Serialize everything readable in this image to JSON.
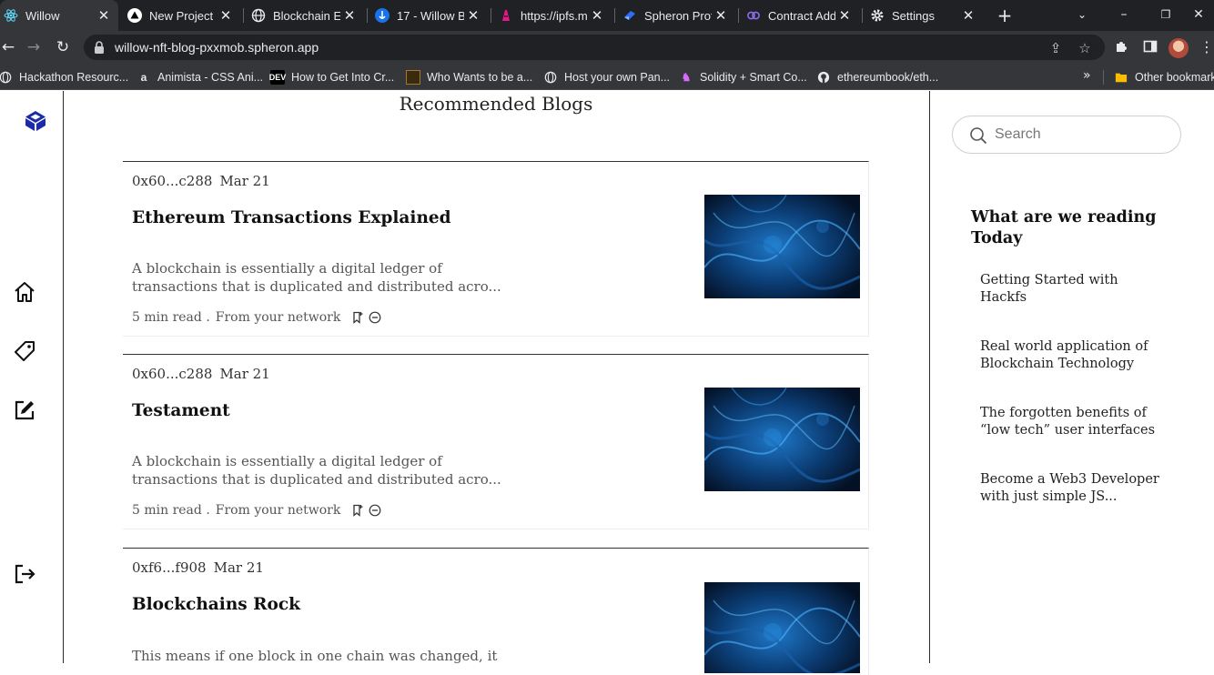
{
  "browser": {
    "tabs": [
      {
        "title": "Willow",
        "icon": "react-icon",
        "active": true
      },
      {
        "title": "New Project -",
        "icon": "triangle-icon"
      },
      {
        "title": "Blockchain Ex",
        "icon": "globe-icon"
      },
      {
        "title": "17 - Willow B",
        "icon": "anchor-icon"
      },
      {
        "title": "https://ipfs.m",
        "icon": "ipfs-icon"
      },
      {
        "title": "Spheron Prot",
        "icon": "spheron-icon"
      },
      {
        "title": "Contract Add",
        "icon": "link-icon"
      },
      {
        "title": "Settings",
        "icon": "gear-icon"
      }
    ],
    "url": "willow-nft-blog-pxxmob.spheron.app",
    "bookmarks": [
      {
        "label": "Hackathon Resourc...",
        "icon": "globe-icon"
      },
      {
        "label": "Animista - CSS Ani...",
        "icon": "animista-icon"
      },
      {
        "label": "How to Get Into Cr...",
        "icon": "dev-icon",
        "badge": "DEV"
      },
      {
        "label": "Who Wants to be a...",
        "icon": "video-icon"
      },
      {
        "label": "Host your own Pan...",
        "icon": "globe-icon"
      },
      {
        "label": "Solidity + Smart Co...",
        "icon": "unicorn-icon"
      },
      {
        "label": "ethereumbook/eth...",
        "icon": "github-icon"
      }
    ],
    "other_bookmarks": "Other bookmark"
  },
  "main": {
    "title": "Recommended Blogs",
    "posts": [
      {
        "author": "0x60...c288",
        "date": "Mar 21",
        "title": "Ethereum Transactions Explained",
        "excerpt": "A blockchain is essentially a digital ledger of transactions that is duplicated and distributed acro...",
        "read_time": "5 min read .",
        "source": "From your network"
      },
      {
        "author": "0x60...c288",
        "date": "Mar 21",
        "title": "Testament",
        "excerpt": "A blockchain is essentially a digital ledger of transactions that is duplicated and distributed acro...",
        "read_time": "5 min read .",
        "source": "From your network"
      },
      {
        "author": "0xf6...f908",
        "date": "Mar 21",
        "title": "Blockchains Rock",
        "excerpt": "This means if one block in one chain was changed, it",
        "read_time": "",
        "source": ""
      }
    ]
  },
  "sidebar": {
    "search_placeholder": "Search",
    "reading_heading": "What are we reading Today",
    "reading_list": [
      "Getting Started with Hackfs",
      "Real world application of Blockchain Technology",
      "The forgotten benefits of “low tech” user interfaces",
      "Become a Web3 Developer with just simple JS..."
    ]
  },
  "colors": {
    "chrome_dark": "#202124",
    "chrome_mid": "#35363a",
    "brand_logo": "#1a2aa8"
  }
}
